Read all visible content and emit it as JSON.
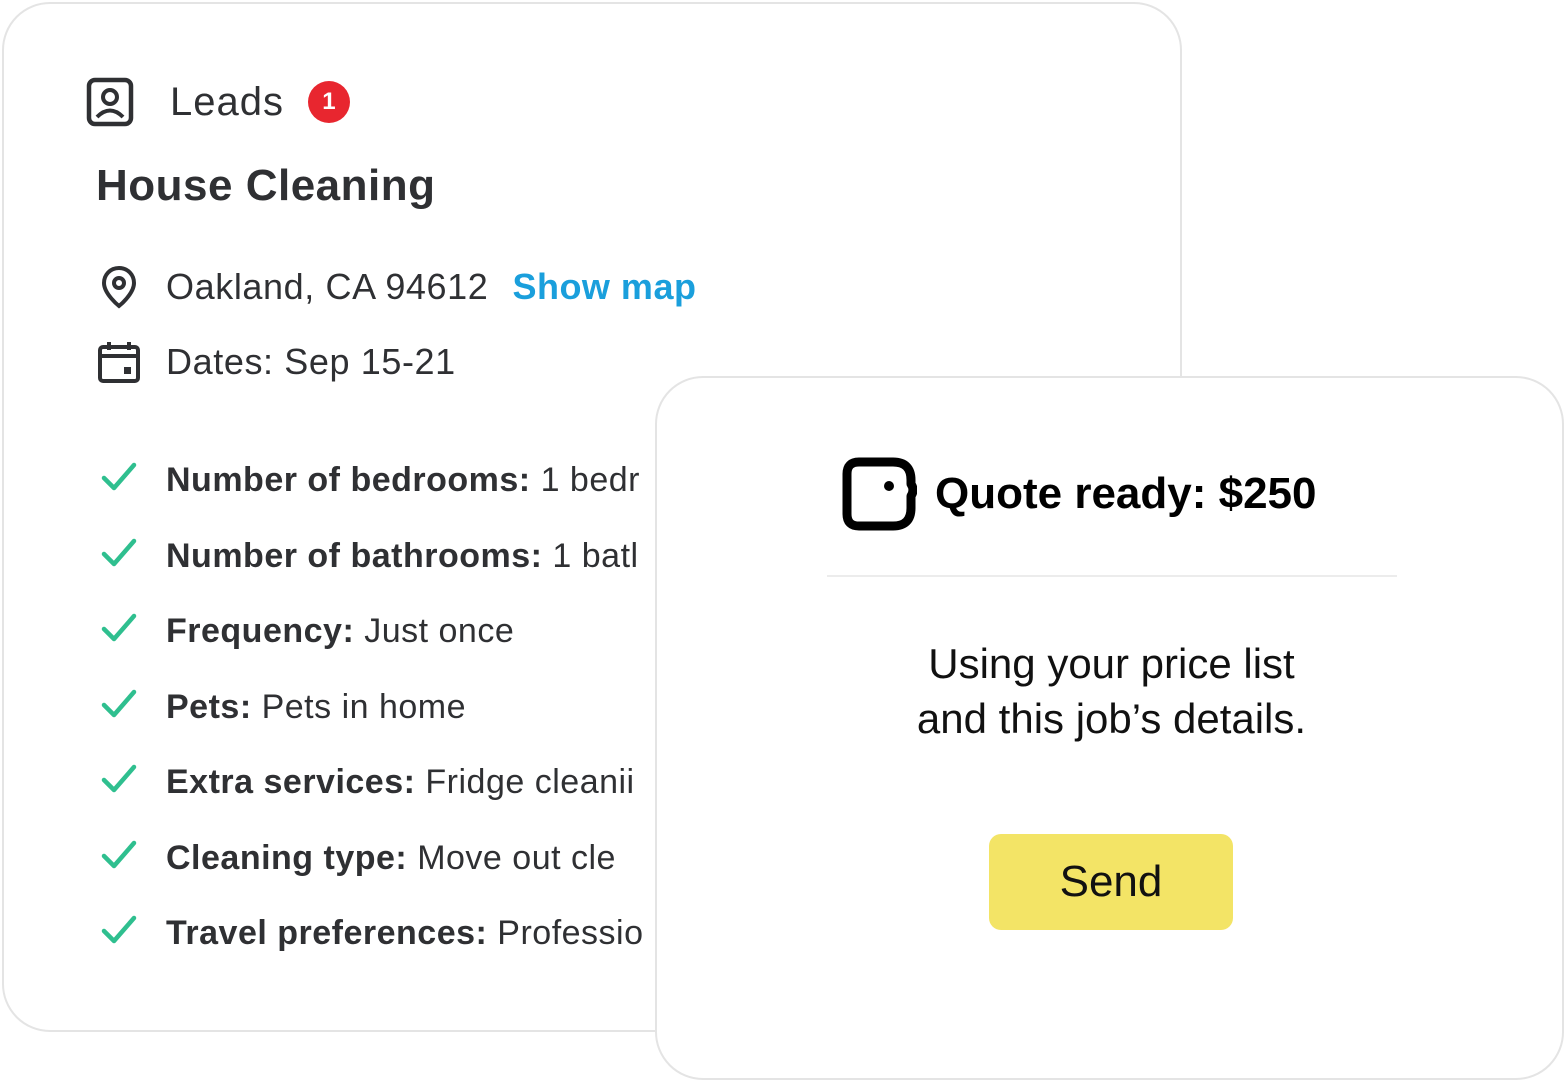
{
  "leads": {
    "label": "Leads",
    "badge_count": "1",
    "icon": "contact-card-icon"
  },
  "job": {
    "title": "House Cleaning",
    "location": "Oakland, CA 94612",
    "show_map_label": "Show map",
    "dates": "Dates: Sep 15-21",
    "details": [
      {
        "key": "Number of bedrooms:",
        "value": "1 bedr"
      },
      {
        "key": "Number of bathrooms:",
        "value": "1 batl"
      },
      {
        "key": "Frequency:",
        "value": "Just once"
      },
      {
        "key": "Pets:",
        "value": "Pets in home"
      },
      {
        "key": "Extra services:",
        "value": "Fridge cleanii"
      },
      {
        "key": "Cleaning type:",
        "value": "Move out cle"
      },
      {
        "key": "Travel preferences:",
        "value": "Professio"
      }
    ]
  },
  "quote": {
    "title": "Quote ready: $250",
    "description_line1": "Using your price list",
    "description_line2": "and this job’s details.",
    "send_label": "Send"
  },
  "colors": {
    "badge": "#e8262f",
    "link": "#1a9fdc",
    "check": "#2fbf8f",
    "send_button": "#f3e466"
  }
}
